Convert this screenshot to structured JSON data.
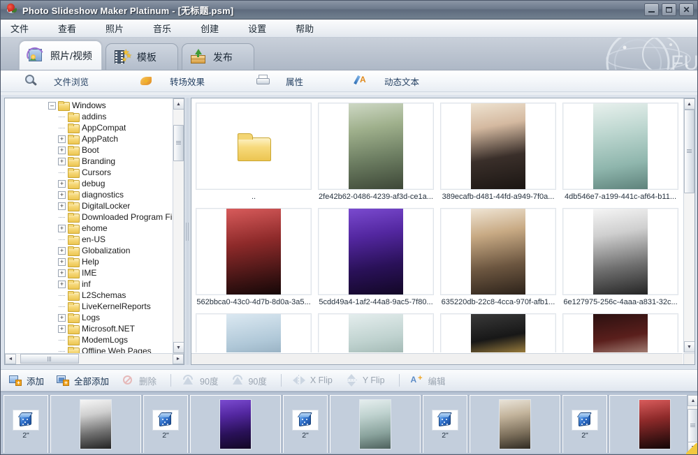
{
  "window": {
    "title": "Photo Slideshow Maker Platinum - [无标题.psm]",
    "app_icon": "app-logo-icon",
    "controls": {
      "minimize": "–",
      "maximize": "□",
      "close": "✕"
    }
  },
  "menubar": {
    "items": [
      {
        "label": "文件"
      },
      {
        "label": "查看"
      },
      {
        "label": "照片"
      },
      {
        "label": "音乐"
      },
      {
        "label": "创建"
      },
      {
        "label": "设置"
      },
      {
        "label": "帮助"
      }
    ]
  },
  "tabs": [
    {
      "label": "照片/视频",
      "icon": "photo-video-icon",
      "active": true
    },
    {
      "label": "模板",
      "icon": "template-icon",
      "active": false
    },
    {
      "label": "发布",
      "icon": "publish-icon",
      "active": false
    }
  ],
  "subtoolbar": {
    "items": [
      {
        "label": "文件浏览",
        "icon": "file-browse-icon"
      },
      {
        "label": "转场效果",
        "icon": "transition-effect-icon"
      },
      {
        "label": "属性",
        "icon": "properties-icon"
      },
      {
        "label": "动态文本",
        "icon": "dynamic-text-icon"
      }
    ]
  },
  "tree": {
    "nodes": [
      {
        "label": "Windows",
        "depth": 0,
        "expander": "minus"
      },
      {
        "label": "addins",
        "depth": 1,
        "expander": "none"
      },
      {
        "label": "AppCompat",
        "depth": 1,
        "expander": "none"
      },
      {
        "label": "AppPatch",
        "depth": 1,
        "expander": "plus"
      },
      {
        "label": "Boot",
        "depth": 1,
        "expander": "plus"
      },
      {
        "label": "Branding",
        "depth": 1,
        "expander": "plus"
      },
      {
        "label": "Cursors",
        "depth": 1,
        "expander": "none"
      },
      {
        "label": "debug",
        "depth": 1,
        "expander": "plus"
      },
      {
        "label": "diagnostics",
        "depth": 1,
        "expander": "plus"
      },
      {
        "label": "DigitalLocker",
        "depth": 1,
        "expander": "plus"
      },
      {
        "label": "Downloaded Program File",
        "depth": 1,
        "expander": "none"
      },
      {
        "label": "ehome",
        "depth": 1,
        "expander": "plus"
      },
      {
        "label": "en-US",
        "depth": 1,
        "expander": "none"
      },
      {
        "label": "Globalization",
        "depth": 1,
        "expander": "plus"
      },
      {
        "label": "Help",
        "depth": 1,
        "expander": "plus"
      },
      {
        "label": "IME",
        "depth": 1,
        "expander": "plus"
      },
      {
        "label": "inf",
        "depth": 1,
        "expander": "plus"
      },
      {
        "label": "L2Schemas",
        "depth": 1,
        "expander": "none"
      },
      {
        "label": "LiveKernelReports",
        "depth": 1,
        "expander": "none"
      },
      {
        "label": "Logs",
        "depth": 1,
        "expander": "plus"
      },
      {
        "label": "Microsoft.NET",
        "depth": 1,
        "expander": "plus"
      },
      {
        "label": "ModemLogs",
        "depth": 1,
        "expander": "none"
      },
      {
        "label": "Offline Web Pages",
        "depth": 1,
        "expander": "none"
      }
    ]
  },
  "thumbnails": {
    "items": [
      {
        "name": "..",
        "kind": "parent-folder",
        "tone": ""
      },
      {
        "name": "2fe42b62-0486-4239-af3d-ce1a...",
        "kind": "image",
        "tone": "p1"
      },
      {
        "name": "389ecafb-d481-44fd-a949-7f0a...",
        "kind": "image",
        "tone": "p2"
      },
      {
        "name": "4db546e7-a199-441c-af64-b11...",
        "kind": "image",
        "tone": "p3"
      },
      {
        "name": "562bbca0-43c0-4d7b-8d0a-3a5...",
        "kind": "image",
        "tone": "p4"
      },
      {
        "name": "5cdd49a4-1af2-44a8-9ac5-7f80...",
        "kind": "image",
        "tone": "p5"
      },
      {
        "name": "635220db-22c8-4cca-970f-afb1...",
        "kind": "image",
        "tone": "p6"
      },
      {
        "name": "6e127975-256c-4aaa-a831-32c...",
        "kind": "image",
        "tone": "p7"
      },
      {
        "name": "",
        "kind": "image",
        "tone": "p8"
      },
      {
        "name": "",
        "kind": "image",
        "tone": "p9"
      },
      {
        "name": "",
        "kind": "image",
        "tone": "p11"
      },
      {
        "name": "",
        "kind": "image",
        "tone": "p12"
      }
    ]
  },
  "actionbar": {
    "items": [
      {
        "label": "添加",
        "icon": "add-icon",
        "disabled": false,
        "sep_after": false
      },
      {
        "label": "全部添加",
        "icon": "add-all-icon",
        "disabled": false,
        "sep_after": false
      },
      {
        "label": "删除",
        "icon": "delete-icon",
        "disabled": true,
        "sep_after": true
      },
      {
        "label": "90度",
        "icon": "rotate-left-icon",
        "disabled": true,
        "sep_after": false
      },
      {
        "label": "90度",
        "icon": "rotate-right-icon",
        "disabled": true,
        "sep_after": true
      },
      {
        "label": "X Flip",
        "icon": "flip-horizontal-icon",
        "disabled": true,
        "sep_after": false
      },
      {
        "label": "Y Flip",
        "icon": "flip-vertical-icon",
        "disabled": true,
        "sep_after": true
      },
      {
        "label": "编辑",
        "icon": "edit-icon",
        "disabled": true,
        "sep_after": false
      }
    ]
  },
  "filmstrip": {
    "transition_icon": "dice-random-transition-icon",
    "entries": [
      {
        "type": "transition",
        "duration": "2\""
      },
      {
        "type": "slide",
        "tone": "p7"
      },
      {
        "type": "transition",
        "duration": "2\""
      },
      {
        "type": "slide",
        "tone": "p5"
      },
      {
        "type": "transition",
        "duration": "2\""
      },
      {
        "type": "slide",
        "tone": "p9"
      },
      {
        "type": "transition",
        "duration": "2\""
      },
      {
        "type": "slide",
        "tone": "p10"
      },
      {
        "type": "transition",
        "duration": "2\""
      },
      {
        "type": "slide",
        "tone": "p4"
      }
    ]
  },
  "scrollbars": {
    "up_arrow": "▲",
    "down_arrow": "▼",
    "left_arrow": "◄",
    "right_arrow": "►"
  }
}
